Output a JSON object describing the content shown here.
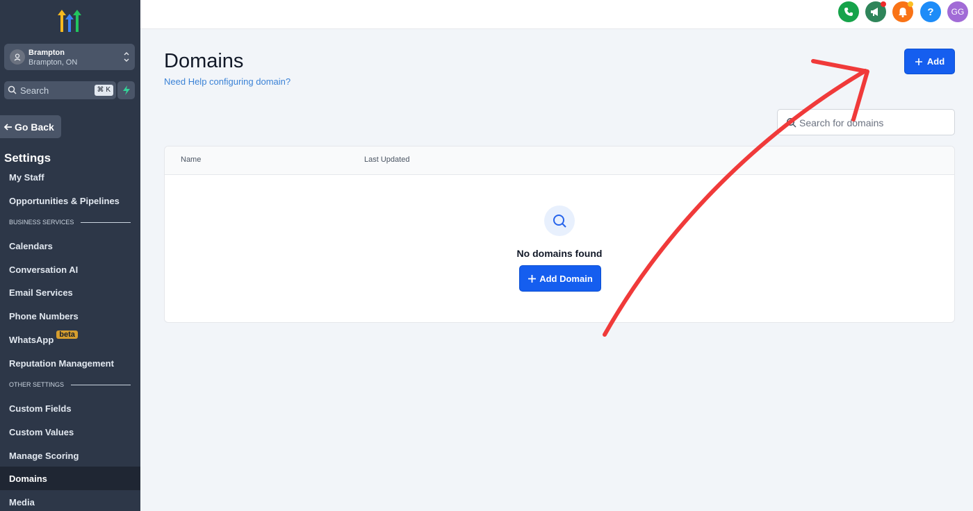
{
  "sidebar": {
    "location": {
      "name": "Brampton",
      "sub": "Brampton, ON"
    },
    "search": {
      "placeholder": "Search",
      "shortcut": "⌘ K"
    },
    "go_back": "Go Back",
    "settings_title": "Settings",
    "items": {
      "my_staff": "My Staff",
      "opportunities": "Opportunities & Pipelines",
      "section_business": "BUSINESS SERVICES",
      "calendars": "Calendars",
      "conversation_ai": "Conversation AI",
      "email_services": "Email Services",
      "phone_numbers": "Phone Numbers",
      "whatsapp": "WhatsApp",
      "whatsapp_badge": "beta",
      "reputation": "Reputation Management",
      "section_other": "OTHER SETTINGS",
      "custom_fields": "Custom Fields",
      "custom_values": "Custom Values",
      "manage_scoring": "Manage Scoring",
      "domains": "Domains",
      "media": "Media"
    }
  },
  "topbar": {
    "avatar_initials": "GG",
    "help_glyph": "?",
    "colors": {
      "phone": "#16a34a",
      "announce": "#2f855a",
      "bell": "#f97316",
      "help": "#1d8cf8",
      "avatar": "#a16bd6"
    }
  },
  "main": {
    "title": "Domains",
    "help_link": "Need Help configuring domain?",
    "add_button": "Add",
    "search_placeholder": "Search for domains",
    "table": {
      "columns": [
        "Name",
        "Last Updated"
      ],
      "empty_text": "No domains found",
      "add_domain_button": "Add Domain"
    }
  },
  "colors": {
    "accent": "#155eef",
    "sidebar_bg": "#2d3748",
    "annotation": "#f03a3a"
  }
}
